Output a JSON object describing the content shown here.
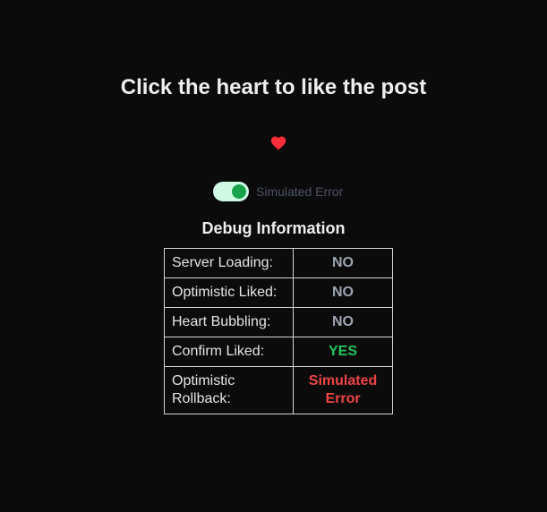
{
  "title": "Click the heart to like the post",
  "heart": {
    "icon": "heart-icon",
    "color": "#ff2d3a",
    "liked": true
  },
  "toggle": {
    "label": "Simulated Error",
    "on": true,
    "track_color": "#d1fae5",
    "knob_color": "#16a34a"
  },
  "debug": {
    "title": "Debug Information",
    "rows": [
      {
        "key": "Server Loading:",
        "value": "NO",
        "color": "#9ca3af"
      },
      {
        "key": "Optimistic Liked:",
        "value": "NO",
        "color": "#9ca3af"
      },
      {
        "key": "Heart Bubbling:",
        "value": "NO",
        "color": "#9ca3af"
      },
      {
        "key": "Confirm Liked:",
        "value": "YES",
        "color": "#22c55e"
      },
      {
        "key": "Optimistic Rollback:",
        "value": "Simulated Error",
        "color": "#ef4444"
      }
    ]
  }
}
